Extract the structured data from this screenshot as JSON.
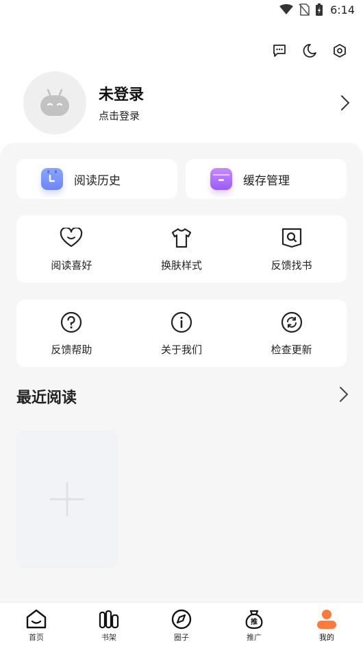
{
  "status_bar": {
    "time": "6:14"
  },
  "top_actions": [
    {
      "icon": "message-icon"
    },
    {
      "icon": "moon-icon"
    },
    {
      "icon": "settings-icon"
    }
  ],
  "profile": {
    "name": "未登录",
    "hint": "点击登录"
  },
  "quick": [
    {
      "label": "阅读历史",
      "icon": "history-icon",
      "color": "#7b95f7"
    },
    {
      "label": "缓存管理",
      "icon": "cache-icon",
      "color": "#a96bf7"
    }
  ],
  "grid_row1": [
    {
      "label": "阅读喜好",
      "icon": "heart-icon"
    },
    {
      "label": "换肤样式",
      "icon": "shirt-icon"
    },
    {
      "label": "反馈找书",
      "icon": "book-search-icon"
    }
  ],
  "grid_row2": [
    {
      "label": "反馈帮助",
      "icon": "help-icon"
    },
    {
      "label": "关于我们",
      "icon": "info-icon"
    },
    {
      "label": "检查更新",
      "icon": "refresh-icon"
    }
  ],
  "recent": {
    "title": "最近阅读"
  },
  "tabs": [
    {
      "label": "首页",
      "icon": "home-icon"
    },
    {
      "label": "书架",
      "icon": "bookshelf-icon"
    },
    {
      "label": "圈子",
      "icon": "compass-icon"
    },
    {
      "label": "推广",
      "icon": "promote-bag-icon",
      "badge": "推"
    },
    {
      "label": "我的",
      "icon": "user-icon",
      "active": true,
      "color": "#ff7a3d"
    }
  ]
}
